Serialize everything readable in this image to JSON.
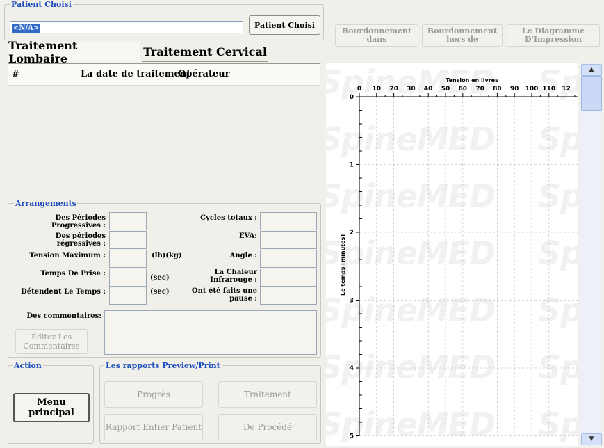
{
  "patient": {
    "group_title": "Patient Choisi",
    "value": "<N/A>",
    "button_label": "Patient Choisi"
  },
  "toolbar": {
    "buzz_in": "Bourdonnement dans",
    "buzz_out": "Bourdonnement hors de",
    "print_chart": "Le Diagramme D'Impression"
  },
  "tabs": [
    "Traitement Lombaire",
    "Traitement Cervical"
  ],
  "table": {
    "columns": [
      "#",
      "La date de traitement",
      "Opérateur"
    ]
  },
  "arrangements": {
    "title": "Arrangements",
    "left": [
      {
        "label": "Des Périodes Progressives :",
        "unit": ""
      },
      {
        "label": "Des périodes régressives :",
        "unit": ""
      },
      {
        "label": "Tension Maximum :",
        "unit": "(lb)(kg)"
      },
      {
        "label": "Temps De Prise :",
        "unit": "(sec)"
      },
      {
        "label": "Détendent Le Temps :",
        "unit": "(sec)"
      }
    ],
    "right": [
      {
        "label": "Cycles totaux :"
      },
      {
        "label": "EVA:"
      },
      {
        "label": "Angle :"
      },
      {
        "label": "La Chaleur Infrarouge :"
      },
      {
        "label": "Ont été faits une pause :"
      }
    ],
    "comments_label": "Des commentaires:",
    "edit_comments": "Éditez Les Commentaires"
  },
  "action": {
    "title": "Action",
    "main_menu": "Menu principal"
  },
  "reports": {
    "title": "Les rapports Preview/Print",
    "progress": "Progrès",
    "treatment": "Traitement",
    "full_report": "Rapport Entier Patient",
    "procedure": "De Procédé"
  },
  "watermark": "SpineMED",
  "chart_data": {
    "type": "line",
    "xlabel": "Tension en livres",
    "ylabel": "Le temps [minutes]",
    "x_ticks": [
      "0",
      "10",
      "20",
      "30",
      "40",
      "50",
      "60",
      "70",
      "80",
      "90",
      "100",
      "110",
      "12"
    ],
    "y_ticks": [
      "0",
      "1",
      "2",
      "3",
      "4",
      "5"
    ],
    "xlim": [
      0,
      120
    ],
    "ylim": [
      0,
      5
    ],
    "y_inverted": true,
    "grid": true,
    "series": []
  }
}
